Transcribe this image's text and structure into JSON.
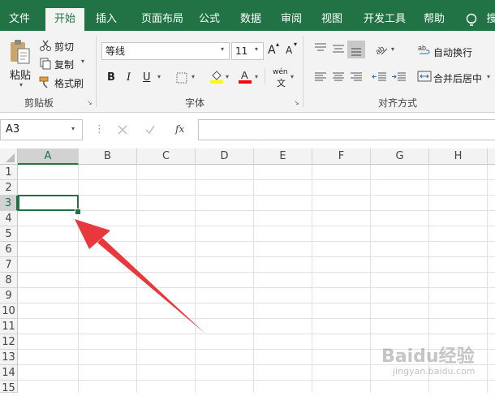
{
  "tabs": [
    "文件",
    "开始",
    "插入",
    "页面布局",
    "公式",
    "数据",
    "审阅",
    "视图",
    "开发工具",
    "帮助"
  ],
  "tabs_extra": "搜",
  "clipboard": {
    "paste": "粘贴",
    "cut": "剪切",
    "copy": "复制",
    "format_painter": "格式刷",
    "label": "剪贴板"
  },
  "font": {
    "name": "等线",
    "size": "11",
    "label": "字体",
    "bold": "B",
    "italic": "I",
    "underline": "U",
    "grow": "A",
    "shrink": "A",
    "phonetic": "wén"
  },
  "alignment": {
    "wrap": "自动换行",
    "merge": "合并后居中",
    "label": "对齐方式"
  },
  "formula_bar": {
    "name_box": "A3",
    "fx": "fx",
    "content": ""
  },
  "columns": [
    "A",
    "B",
    "C",
    "D",
    "E",
    "F",
    "G",
    "H"
  ],
  "rows": [
    "1",
    "2",
    "3",
    "4",
    "5",
    "6",
    "7",
    "8",
    "9",
    "10",
    "11",
    "12",
    "13",
    "14",
    "15"
  ],
  "selected_cell": "A3",
  "watermark": "Baidu经验",
  "watermark_sub": "jingyan.baidu.com",
  "colors": {
    "excel_green": "#217346",
    "arrow": "#e8383d",
    "fill_yellow": "#ffff00",
    "font_red": "#ff0000"
  }
}
